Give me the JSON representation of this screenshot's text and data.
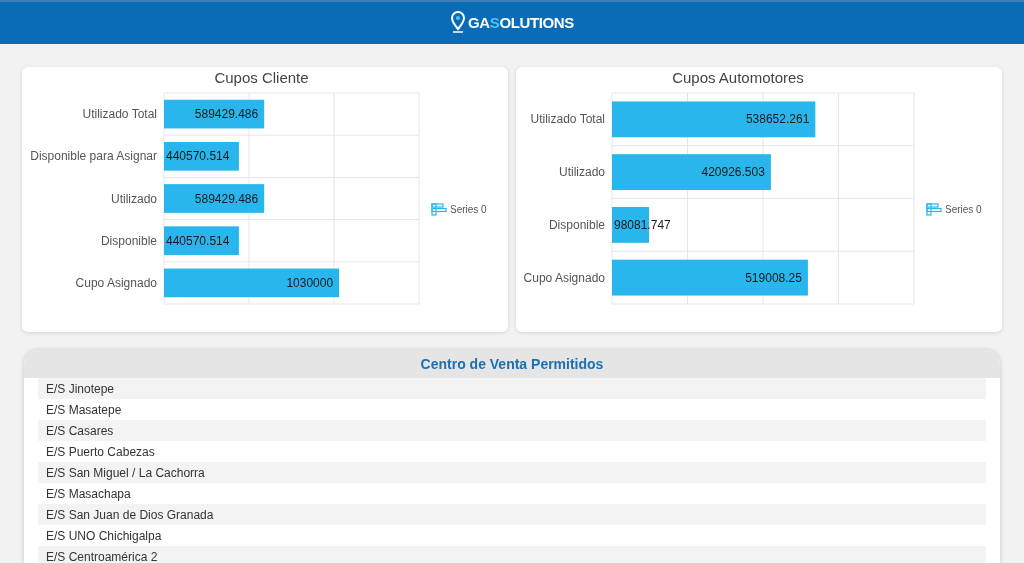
{
  "header": {
    "logo_parts": [
      {
        "text": "GA",
        "color": "#ffffff"
      },
      {
        "text": "S",
        "color": "#4fc3f7"
      },
      {
        "text": "OLUTIONS",
        "color": "#ffffff"
      }
    ]
  },
  "charts": [
    {
      "chart_data": {
        "type": "bar",
        "orientation": "horizontal",
        "title": "Cupos Cliente",
        "categories": [
          "Utilizado Total",
          "Disponible para Asignar",
          "Utilizado",
          "Disponible",
          "Cupo Asignado"
        ],
        "series": [
          {
            "name": "Series 0",
            "color": "#29b6ec",
            "values": [
              589429.486,
              440570.514,
              589429.486,
              440570.514,
              1030000
            ]
          }
        ],
        "value_labels": [
          "589429.486",
          "440570.514",
          "589429.486",
          "440570.514",
          "1030000"
        ],
        "data_labels": true,
        "xlim": [
          0,
          1500000
        ]
      }
    },
    {
      "chart_data": {
        "type": "bar",
        "orientation": "horizontal",
        "title": "Cupos Automotores",
        "categories": [
          "Utilizado Total",
          "Utilizado",
          "Disponible",
          "Cupo Asignado"
        ],
        "series": [
          {
            "name": "Series 0",
            "color": "#29b6ec",
            "values": [
              538652.261,
              420926.503,
              98081.747,
              519008.25
            ]
          }
        ],
        "value_labels": [
          "538652.261",
          "420926.503",
          "98081.747",
          "519008.25"
        ],
        "data_labels": true,
        "xlim": [
          0,
          800000
        ]
      }
    }
  ],
  "sales_centers": {
    "title": "Centro de Venta Permitidos",
    "items": [
      "E/S Jinotepe",
      "E/S Masatepe",
      "E/S Casares",
      "E/S Puerto Cabezas",
      "E/S San Miguel / La Cachorra",
      "E/S Masachapa",
      "E/S San Juan de Dios Granada",
      "E/S UNO Chichigalpa",
      "E/S Centroamérica 2"
    ]
  }
}
